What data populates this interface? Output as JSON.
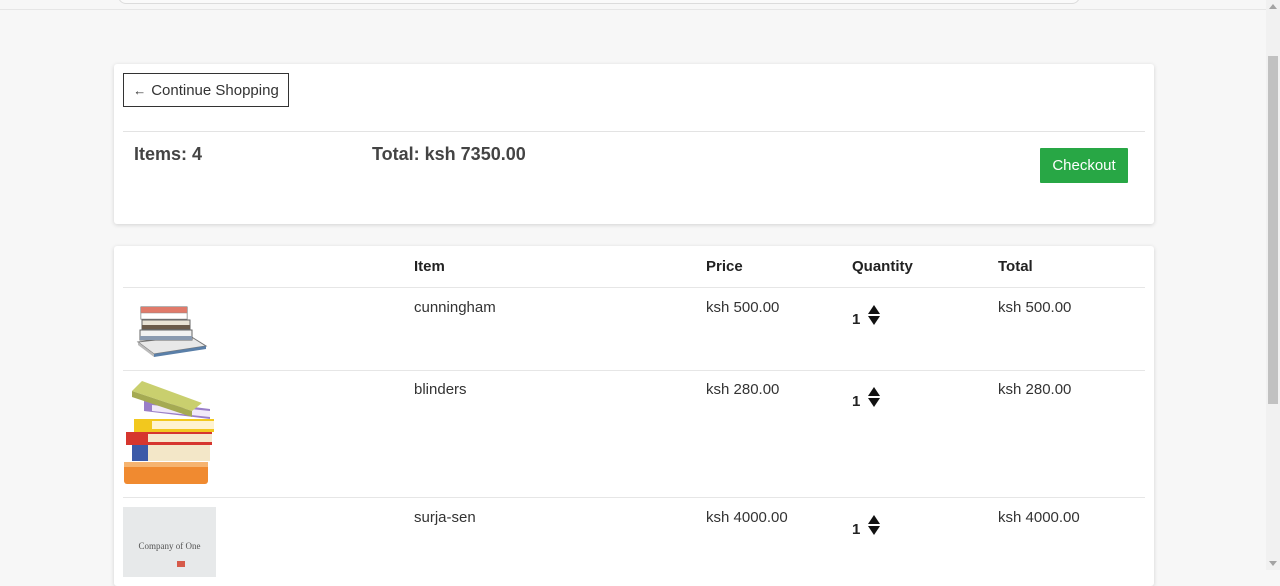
{
  "summary": {
    "continue_label": "Continue Shopping",
    "continue_arrow": "←",
    "items_label": "Items: 4",
    "total_label": "Total: ksh 7350.00",
    "checkout_label": "Checkout"
  },
  "table": {
    "headers": {
      "item": "Item",
      "price": "Price",
      "quantity": "Quantity",
      "total": "Total"
    },
    "rows": [
      {
        "name": "cunningham",
        "price": "ksh 500.00",
        "quantity": "1",
        "total": "ksh 500.00"
      },
      {
        "name": "blinders",
        "price": "ksh 280.00",
        "quantity": "1",
        "total": "ksh 280.00"
      },
      {
        "name": "surja-sen",
        "price": "ksh 4000.00",
        "quantity": "1",
        "total": "ksh 4000.00"
      }
    ]
  },
  "book_cover_text": "Company of One",
  "colors": {
    "checkout": "#28a745",
    "background": "#f7f7f7"
  }
}
